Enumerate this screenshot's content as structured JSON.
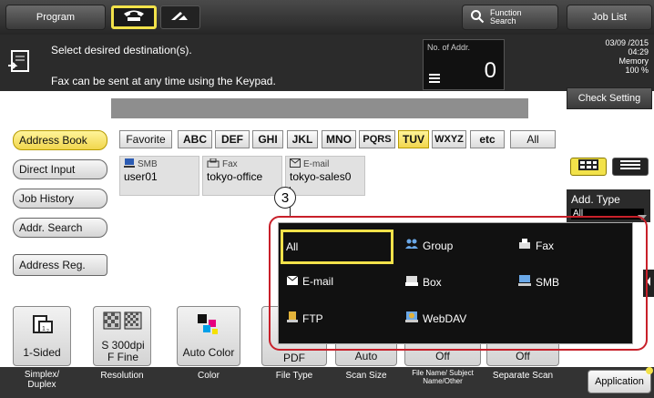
{
  "topbar": {
    "program_label": "Program",
    "function_search_label": "Function Search",
    "job_list_label": "Job List"
  },
  "message": {
    "line1": "Select desired destination(s).",
    "line2": "Fax can be sent at any time using the Keypad.",
    "no_of_addr_label": "No. of Addr.",
    "no_of_addr_value": "0"
  },
  "status": {
    "date": "03/09 /2015",
    "time": "04:29",
    "memory_label": "Memory",
    "memory_value": "100 %"
  },
  "check_setting_label": "Check Setting",
  "sidebar": {
    "items": [
      {
        "label": "Address Book"
      },
      {
        "label": "Direct Input"
      },
      {
        "label": "Job History"
      },
      {
        "label": "Addr. Search"
      },
      {
        "label": "Address Reg."
      }
    ]
  },
  "index_tabs": [
    "Favorite",
    "ABC",
    "DEF",
    "GHI",
    "JKL",
    "MNO",
    "PQRS",
    "TUV",
    "WXYZ",
    "etc",
    "All"
  ],
  "selected_index": "TUV",
  "destinations": [
    {
      "type": "SMB",
      "name": "user01"
    },
    {
      "type": "Fax",
      "name": "tokyo-office"
    },
    {
      "type": "E-mail",
      "name": "tokyo-sales0"
    }
  ],
  "callout_label": "3",
  "add_type": {
    "label": "Add. Type",
    "selected_value": "All"
  },
  "popup": {
    "options": [
      {
        "label": "All",
        "icon": "none"
      },
      {
        "label": "Group",
        "icon": "group-icon"
      },
      {
        "label": "Fax",
        "icon": "fax-icon"
      },
      {
        "label": "E-mail",
        "icon": "email-icon"
      },
      {
        "label": "Box",
        "icon": "box-icon"
      },
      {
        "label": "SMB",
        "icon": "smb-icon"
      },
      {
        "label": "FTP",
        "icon": "ftp-icon"
      },
      {
        "label": "WebDAV",
        "icon": "webdav-icon"
      }
    ],
    "selected": "All"
  },
  "function_buttons": [
    {
      "value": "1-Sided",
      "label": "Simplex/ Duplex"
    },
    {
      "value": "S 300dpi F Fine",
      "label": "Resolution"
    },
    {
      "value": "Auto Color",
      "label": "Color"
    },
    {
      "value": "PDF",
      "label": "File Type"
    },
    {
      "value": "Auto",
      "label": "Scan Size"
    },
    {
      "value": "Off",
      "label": "File Name/ Subject Name/Other"
    },
    {
      "value": "Off",
      "label": "Separate Scan"
    }
  ],
  "application_label": "Application",
  "colors": {
    "highlight_yellow": "#f2e24a",
    "callout_red": "#c8202a",
    "dark_panel": "#111111"
  }
}
